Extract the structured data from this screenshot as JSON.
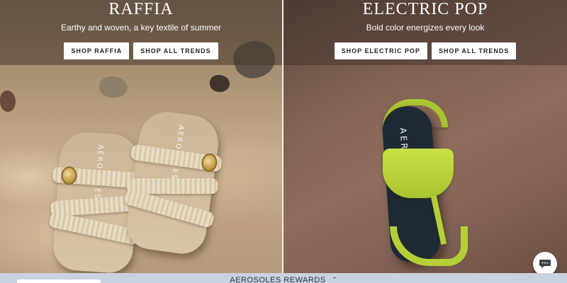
{
  "promos": {
    "raffia": {
      "title": "RAFFIA",
      "subtitle": "Earthy and woven, a key textile of summer",
      "primary_button": "SHOP RAFFIA",
      "secondary_button": "SHOP ALL TRENDS",
      "product_brand": "AEROSOLES"
    },
    "electric_pop": {
      "title": "ELECTRIC POP",
      "subtitle": "Bold color energizes every look",
      "primary_button": "SHOP ELECTRIC POP",
      "secondary_button": "SHOP ALL TRENDS",
      "product_brand": "AEROSOLES"
    }
  },
  "rewards_bar": {
    "label": "AEROSOLES REWARDS",
    "chevron_icon": "chevron-up-icon"
  },
  "chat": {
    "icon": "chat-bubble-icon"
  },
  "colors": {
    "overlay_text": "#ffffff",
    "button_bg": "#ffffff",
    "button_text": "#222222",
    "rewards_bg": "#c9d2df",
    "rewards_text": "#27323f",
    "shoe_accent": "#b8d33a"
  }
}
